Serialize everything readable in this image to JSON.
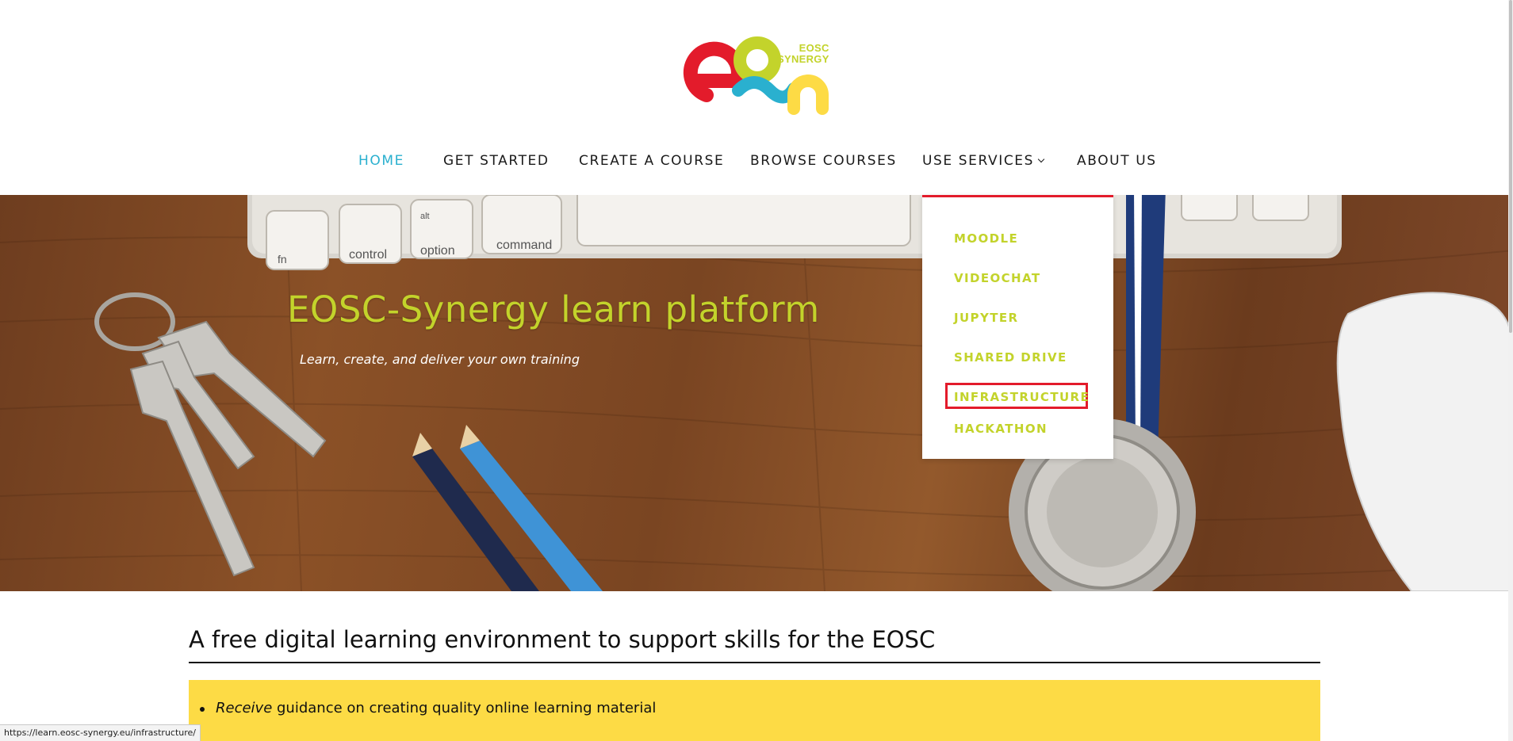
{
  "logo": {
    "text_line1": "EOSC",
    "text_line2": "SYNERGY",
    "colors": {
      "red": "#e31b2b",
      "green": "#c3d32b",
      "blue": "#2ab0cf",
      "yellow": "#fddb45"
    }
  },
  "nav": {
    "items": [
      {
        "label": "HOME",
        "active": true
      },
      {
        "label": "GET STARTED",
        "active": false
      },
      {
        "label": "CREATE A COURSE",
        "active": false
      },
      {
        "label": "BROWSE COURSES",
        "active": false
      },
      {
        "label": "USE SERVICES",
        "active": false,
        "has_dropdown": true
      },
      {
        "label": "ABOUT US",
        "active": false
      }
    ],
    "active_color": "#2ab0cf"
  },
  "hero": {
    "title": "EOSC-Synergy learn platform",
    "subtitle": "Learn, create, and deliver your own training",
    "keyboard_keys": [
      "fn",
      "control",
      "alt",
      "option",
      "command"
    ]
  },
  "dropdown": {
    "items": [
      {
        "label": "MOODLE"
      },
      {
        "label": "VIDEOCHAT"
      },
      {
        "label": "JUPYTER"
      },
      {
        "label": "SHARED DRIVE"
      },
      {
        "label": "INFRASTRUCTURE",
        "highlighted": true
      },
      {
        "label": "HACKATHON"
      }
    ],
    "item_color": "#c3d32b",
    "border_color": "#e31b2b"
  },
  "content": {
    "heading": "A free digital learning environment to support skills for the EOSC",
    "bullets": [
      {
        "emphasis": "Receive",
        "text": " guidance on creating quality online learning material"
      }
    ],
    "box_color": "#fddb45"
  },
  "status_bar": {
    "url": "https://learn.eosc-synergy.eu/infrastructure/"
  }
}
